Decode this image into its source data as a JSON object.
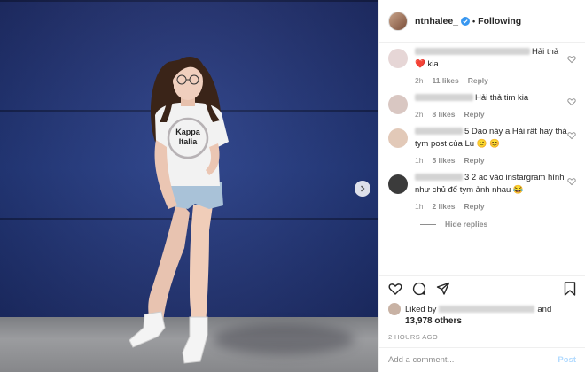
{
  "header": {
    "username": "ntnhalee_",
    "separator": "•",
    "follow_status": "Following"
  },
  "photo": {
    "shirt_brand": "Kappa",
    "shirt_text": "Italia"
  },
  "comments": [
    {
      "text": "Hải thả ❤️ kia",
      "time": "2h",
      "likes": "11 likes",
      "reply": "Reply",
      "avatar_color": "#e6d6d6"
    },
    {
      "text": "Hải thả tim kia",
      "time": "2h",
      "likes": "8 likes",
      "reply": "Reply",
      "avatar_color": "#d9c7c2"
    },
    {
      "text": "5 Dạo này a Hải rất hay thả tym post của Lu 🙂 😊",
      "time": "1h",
      "likes": "5 likes",
      "reply": "Reply",
      "avatar_color": "#e2c9b8"
    },
    {
      "text": "3 2 ac vào instargram hình như chủ để tym ảnh nhau 😂",
      "time": "1h",
      "likes": "2 likes",
      "reply": "Reply",
      "avatar_color": "#3b3b3b"
    }
  ],
  "hide_replies": "Hide replies",
  "actions": {
    "liked_by": "Liked by",
    "and": "and",
    "likes_count": "13,978 others",
    "time_ago": "2 HOURS AGO"
  },
  "composer": {
    "placeholder": "Add a comment...",
    "post_label": "Post"
  },
  "colors": {
    "verified": "#3897f0",
    "post_disabled": "#b3dbff",
    "meta": "#8e8e8e"
  }
}
